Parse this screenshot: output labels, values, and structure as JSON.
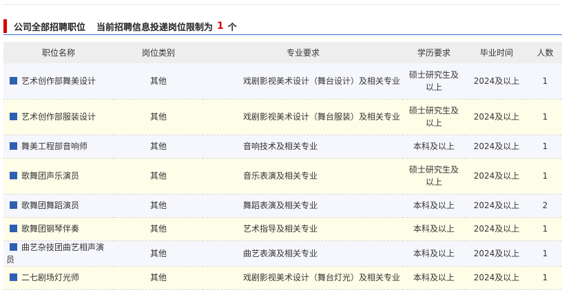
{
  "header": {
    "title": "公司全部招聘职位",
    "limit_prefix": "当前招聘信息投递岗位限制为",
    "limit_value": "1",
    "limit_unit": "个"
  },
  "table": {
    "columns": [
      "职位名称",
      "岗位类别",
      "专业要求",
      "学历要求",
      "毕业时间",
      "人数"
    ],
    "rows": [
      {
        "name": "艺术创作部舞美设计",
        "category": "其他",
        "major": "戏剧影视美术设计（舞台设计）及相关专业",
        "education": "硕士研究生及以上",
        "grad": "2024及以上",
        "count": "1"
      },
      {
        "name": "艺术创作部服装设计",
        "category": "其他",
        "major": "戏剧影视美术设计（舞台服装）及相关专业",
        "education": "硕士研究生及以上",
        "grad": "2024及以上",
        "count": "1"
      },
      {
        "name": "舞美工程部音响师",
        "category": "其他",
        "major": "音响技术及相关专业",
        "education": "本科及以上",
        "grad": "2024及以上",
        "count": "1"
      },
      {
        "name": "歌舞团声乐演员",
        "category": "其他",
        "major": "音乐表演及相关专业",
        "education": "硕士研究生及以上",
        "grad": "2024及以上",
        "count": "1"
      },
      {
        "name": "歌舞团舞蹈演员",
        "category": "其他",
        "major": "舞蹈表演及相关专业",
        "education": "本科及以上",
        "grad": "2024及以上",
        "count": "2"
      },
      {
        "name": "歌舞团钢琴伴奏",
        "category": "其他",
        "major": "艺术指导及相关专业",
        "education": "本科及以上",
        "grad": "2024及以上",
        "count": "1"
      },
      {
        "name": "曲艺杂技团曲艺相声演员",
        "category": "其他",
        "major": "曲艺表演及相关专业",
        "education": "本科及以上",
        "grad": "2024及以上",
        "count": "1"
      },
      {
        "name": "二七剧场灯光师",
        "category": "其他",
        "major": "戏剧影视美术设计（舞台灯光）及相关专业",
        "education": "本科及以上",
        "grad": "2024及以上",
        "count": "1"
      }
    ]
  },
  "colors": {
    "accent_red": "#d40000",
    "accent_blue": "#2f6fd6",
    "row_odd": "#f6f7fc",
    "row_even": "#fdfde8"
  },
  "icons": {
    "row_marker": "square-bullet-icon"
  }
}
